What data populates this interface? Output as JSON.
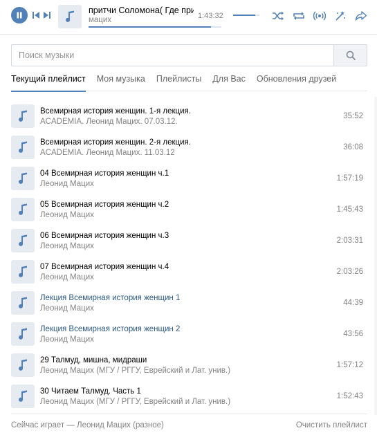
{
  "colors": {
    "accent": "#5181b8",
    "link": "#2a5885",
    "secondary_text": "#828282",
    "thumb_bg": "#e5ebf1"
  },
  "player": {
    "title": "притчи Соломона( Где прир…",
    "artist": "мацих",
    "time": "1:43:32",
    "progress": 0.92,
    "volume": 0.85,
    "icons": [
      "pause-icon",
      "previous-icon",
      "next-icon",
      "note-icon",
      "shuffle-icon",
      "repeat-icon",
      "broadcast-icon",
      "similar-icon",
      "share-icon"
    ]
  },
  "search": {
    "placeholder": "Поиск музыки",
    "value": ""
  },
  "tabs": [
    {
      "label": "Текущий плейлист",
      "active": true
    },
    {
      "label": "Моя музыка"
    },
    {
      "label": "Плейлисты"
    },
    {
      "label": "Для Вас"
    },
    {
      "label": "Обновления друзей"
    }
  ],
  "tracks": [
    {
      "title": "Всемирная история женщин. 1-я лекция.",
      "artist": "ACADEMIA. Леонид Мацих. 07.03.12.",
      "duration": "35:52",
      "linked": false
    },
    {
      "title": "Всемирная история женщин. 2-я лекция.",
      "artist": "ACADEMIA. Леонид Мацих. 11.03.12",
      "duration": "36:08",
      "linked": false
    },
    {
      "title": "04 Всемирная история женщин ч.1",
      "artist": "Леонид Мацих",
      "duration": "1:57:19",
      "linked": false
    },
    {
      "title": "05 Всемирная история женщин ч.2",
      "artist": "Леонид Мацих",
      "duration": "1:45:43",
      "linked": false
    },
    {
      "title": "06 Всемирная история женщин ч.3",
      "artist": "Леонид Мацих",
      "duration": "2:03:31",
      "linked": false
    },
    {
      "title": "07 Всемирная история женщин ч.4",
      "artist": "Леонид Мацих",
      "duration": "2:03:26",
      "linked": false
    },
    {
      "title": "Лекция Всемирная история женщин 1",
      "artist": "Леонид Мацих",
      "duration": "44:39",
      "linked": true
    },
    {
      "title": "Лекция Всемирная история женщин 2",
      "artist": "Леонид Мацих",
      "duration": "43:56",
      "linked": true
    },
    {
      "title": "29 Талмуд, мишна, мидраши",
      "artist": "Леонид Мацих (МГУ / РГГУ, Еврейский и Лат. унив.)",
      "duration": "1:57:12",
      "linked": false
    },
    {
      "title": "30 Читаем Талмуд. Часть 1",
      "artist": "Леонид Мацих (МГУ / РГГУ, Еврейский и Лат. унив.)",
      "duration": "1:52:43",
      "linked": false
    }
  ],
  "footer": {
    "now_playing": "Сейчас играет — Леонид Мацих (разное)",
    "clear_label": "Очистить плейлист"
  }
}
